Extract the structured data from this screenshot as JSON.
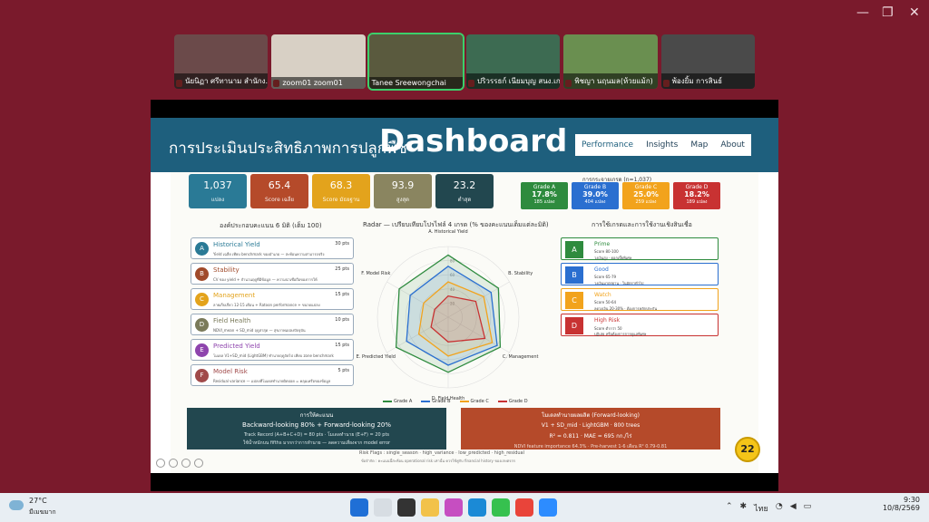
{
  "window_controls": {
    "minimize": "—",
    "restore": "❐",
    "close": "✕"
  },
  "participants": [
    {
      "name": "นัยนิฏา ศรีทานาม สำนักง...",
      "color": "#6b4a4a"
    },
    {
      "name": "zoom01 zoom01",
      "color": "#d8d0c5"
    },
    {
      "name": "Tanee Sreewongchai",
      "color": "#5a5a3e",
      "active": true
    },
    {
      "name": "ปริวรรธก์ เนียมบุญ สนง.เก...",
      "color": "#3d6b52"
    },
    {
      "name": "พิชญา นฤนมล(ห้วยแม้ก)",
      "color": "#6a8f50"
    },
    {
      "name": "พ้องยิ้ม การสินธ์",
      "color": "#4a4a4a"
    }
  ],
  "slide": {
    "title_th": "การประเมินประสิทธิภาพการปลูกพืช",
    "title_en": "Dashboard",
    "nav": [
      "Performance",
      "Insights",
      "Map",
      "About"
    ],
    "stats": [
      {
        "value": "1,037",
        "label": "แปลง",
        "color": "#2a7a96"
      },
      {
        "value": "65.4",
        "label": "Score เฉลี่ย",
        "color": "#b54a2a"
      },
      {
        "value": "68.3",
        "label": "Score มัธยฐาน",
        "color": "#e3a31c"
      },
      {
        "value": "93.9",
        "label": "สูงสุด",
        "color": "#8a8560"
      },
      {
        "value": "23.2",
        "label": "ต่ำสุด",
        "color": "#22474f"
      }
    ],
    "grade_title": "การกระจายเกรด (n=1,037)",
    "grades": [
      {
        "name": "Grade A",
        "pct": "17.8%",
        "count": "185 แปลง",
        "color": "#2e8b3e"
      },
      {
        "name": "Grade B",
        "pct": "39.0%",
        "count": "404 แปลง",
        "color": "#2a6fd0"
      },
      {
        "name": "Grade C",
        "pct": "25.0%",
        "count": "259 แปลง",
        "color": "#f2a31c"
      },
      {
        "name": "Grade D",
        "pct": "18.2%",
        "count": "189 แปลง",
        "color": "#c83232"
      }
    ],
    "dimensions_title": "องค์ประกอบคะแนน 6 มิติ (เต็ม 100)",
    "dimensions": [
      {
        "letter": "A",
        "name": "Historical Yield",
        "desc": "Yield เฉลี่ย เทียบ benchmark ของอำเภอ — สะท้อนความสามารถจริง",
        "points": "30 pts",
        "color": "#2a7a96"
      },
      {
        "letter": "B",
        "name": "Stability",
        "desc": "CV ของ yield + จำนวนฤดูที่มีข้อมูล — ความน่าเชื่อถือของการให้",
        "points": "25 pts",
        "color": "#a04a2a"
      },
      {
        "letter": "C",
        "name": "Management",
        "desc": "ลายเก็บเกี่ยว 12-15 เดือน + Ratoon performance + ขนาดแปลง",
        "points": "15 pts",
        "color": "#e3a31c"
      },
      {
        "letter": "D",
        "name": "Field Health",
        "desc": "NDVI_mean + SD_mid ฤดูล่าสุด — สุขภาพแปลงปัจจุบัน",
        "points": "10 pts",
        "color": "#7a7a5a"
      },
      {
        "letter": "E",
        "name": "Predicted Yield",
        "desc": "โมเดล V1+SD_mid (LightGBM) ทำนายฤดูถัดไป เทียบ zone benchmark",
        "points": "15 pts",
        "color": "#8e44ad"
      },
      {
        "letter": "F",
        "name": "Model Risk",
        "desc": "Residual variance — แปลงที่โมเดลทำนายผิดบ่อย = คลุมเครือของข้อมูล",
        "points": "5 pts",
        "color": "#a04a4a"
      }
    ],
    "radar_title": "Radar — เปรียบเทียบโปรไฟล์ 4 เกรด (% ของคะแนนเต็มแต่ละมิติ)",
    "radar_axes": [
      "A. Historical Yield",
      "B. Stability",
      "C. Management",
      "D. Field Health",
      "E. Predicted Yield",
      "F. Model Risk"
    ],
    "radar_ticks": [
      "20",
      "40",
      "60",
      "80"
    ],
    "radar_legend": [
      "Grade A",
      "Grade B",
      "Grade C",
      "Grade D"
    ],
    "usage_title": "การใช้เกรดและการใช้งานเชิงสินเชื่อ",
    "usage": [
      {
        "grade": "A",
        "name": "Prime",
        "score": "Score 80-100",
        "desc": "วงเงินสูง · ดอกเบี้ยพิเศษ",
        "color": "#2e8b3e"
      },
      {
        "grade": "B",
        "name": "Good",
        "score": "Score 65-79",
        "desc": "วงเงินมาตรฐาน · ในอัตราทั่วไป",
        "color": "#2a6fd0"
      },
      {
        "grade": "C",
        "name": "Watch",
        "score": "Score 50-64",
        "desc": "ลดวงเงิน 20-30% · ต้องการหลักประกัน",
        "color": "#f2a31c"
      },
      {
        "grade": "D",
        "name": "High Risk",
        "score": "Score ต่ำกว่า 50",
        "desc": "ปฏิเสธ หรือต้องการการดูแลพิเศษ",
        "color": "#c83232"
      }
    ],
    "method": {
      "title": "การให้คะแนน",
      "main": "Backward-looking 80% + Forward-looking 20%",
      "line1": "Track Record (A+B+C+D) = 80 pts · โมเดลทำนาย (E+F) = 20 pts",
      "line2": "ใช้น้ำหนักบน fifths มากกว่าการทำนาย — ลดความเสี่ยงจาก model error"
    },
    "model": {
      "title": "โมเดลทำนายผลผลิต (Forward-looking)",
      "main": "V1 + SD_mid · LightGBM · 800 trees",
      "metrics": "R² = 0.811 · MAE = 695 กก./ไร่",
      "note": "NDVI feature importance 64.3% · Pre-harvest 1-6 เดือน R² 0.79-0.81"
    },
    "flags": "Risk Flags : single_season · high_variance · low_predicted · high_residual",
    "footnote": "ข้อจำกัด : คะแนนนี้สะท้อน operational risk เท่านั้น ควรใช้คู่กับ financial history ของเกษตรกร",
    "badge": "22"
  },
  "chart_data": {
    "type": "radar",
    "title": "Radar — เปรียบเทียบโปรไฟล์ 4 เกรด (% ของคะแนนเต็มแต่ละมิติ)",
    "categories": [
      "A. Historical Yield",
      "B. Stability",
      "C. Management",
      "D. Field Health",
      "E. Predicted Yield",
      "F. Model Risk"
    ],
    "ylim": [
      0,
      100
    ],
    "series": [
      {
        "name": "Grade A",
        "values": [
          88,
          82,
          85,
          78,
          85,
          80
        ],
        "color": "#2e8b3e"
      },
      {
        "name": "Grade B",
        "values": [
          72,
          70,
          80,
          68,
          68,
          62
        ],
        "color": "#2a6fd0"
      },
      {
        "name": "Grade C",
        "values": [
          50,
          58,
          72,
          55,
          48,
          40
        ],
        "color": "#f2a31c"
      },
      {
        "name": "Grade D",
        "values": [
          30,
          45,
          60,
          35,
          28,
          22
        ],
        "color": "#c83232"
      }
    ]
  },
  "taskbar": {
    "temp": "27°C",
    "weather": "มีเมฆมาก",
    "lang": "ไทย",
    "time": "9:30",
    "date": "10/8/2569"
  }
}
